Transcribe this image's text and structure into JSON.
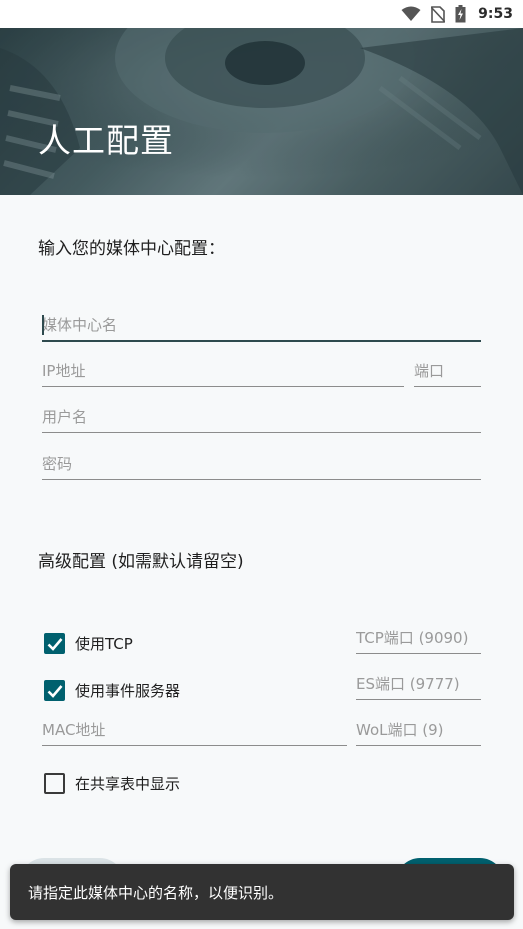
{
  "status_bar": {
    "time": "9:53",
    "icons": [
      "wifi-icon",
      "no-sim-icon",
      "battery-charging-icon"
    ]
  },
  "header": {
    "title": "人工配置"
  },
  "form": {
    "intro": "输入您的媒体中心配置：",
    "name_placeholder": "媒体中心名",
    "ip_placeholder": "IP地址",
    "port_placeholder": "端口",
    "username_placeholder": "用户名",
    "password_placeholder": "密码"
  },
  "advanced": {
    "title": "高级配置 (如需默认请留空)",
    "use_tcp_label": "使用TCP",
    "use_tcp_checked": true,
    "tcp_port_placeholder": "TCP端口 (9090)",
    "use_event_server_label": "使用事件服务器",
    "use_event_server_checked": true,
    "es_port_placeholder": "ES端口 (9777)",
    "mac_placeholder": "MAC地址",
    "wol_port_placeholder": "WoL端口 (9)",
    "show_in_share_label": "在共享表中显示",
    "show_in_share_checked": false
  },
  "snackbar": {
    "message": "请指定此媒体中心的名称，以便识别。"
  },
  "colors": {
    "accent": "#00606e",
    "snackbar_bg": "#323232",
    "background": "#f7f9fa"
  }
}
